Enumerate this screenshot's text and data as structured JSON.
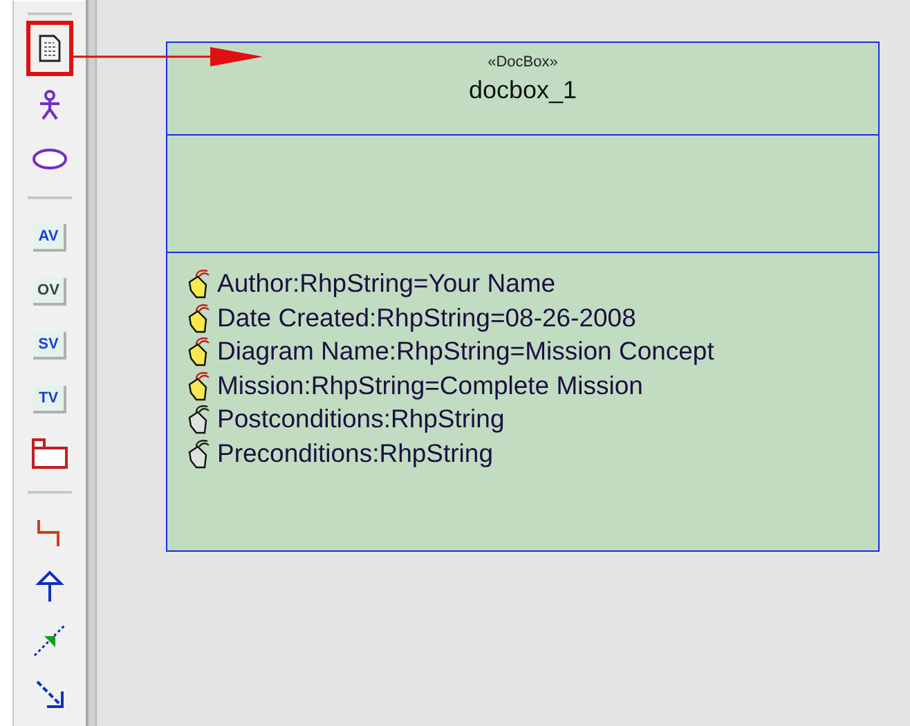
{
  "toolbar": {
    "tools": [
      {
        "kind": "document",
        "highlighted": true
      },
      {
        "kind": "actor",
        "highlighted": false
      },
      {
        "kind": "ellipse",
        "highlighted": false
      },
      {
        "kind": "separator"
      },
      {
        "kind": "text",
        "label": "AV",
        "color": "#2040d0",
        "highlighted": false
      },
      {
        "kind": "text",
        "label": "OV",
        "color": "#404040",
        "highlighted": false
      },
      {
        "kind": "text",
        "label": "SV",
        "color": "#2040d0",
        "highlighted": false
      },
      {
        "kind": "text",
        "label": "TV",
        "color": "#2040d0",
        "highlighted": false
      },
      {
        "kind": "folder",
        "highlighted": false
      },
      {
        "kind": "separator"
      },
      {
        "kind": "connector",
        "highlighted": false
      },
      {
        "kind": "arrow-up",
        "highlighted": false
      },
      {
        "kind": "dependency",
        "highlighted": false
      },
      {
        "kind": "arrow-diagonal",
        "highlighted": false
      }
    ]
  },
  "callout_arrow": true,
  "class_box": {
    "stereotype": "«DocBox»",
    "name": "docbox_1",
    "attributes": [
      {
        "text": "Author:RhpString=Your Name",
        "kind": "valued"
      },
      {
        "text": "Date Created:RhpString=08-26-2008",
        "kind": "valued"
      },
      {
        "text": "Diagram Name:RhpString=Mission Concept",
        "kind": "valued"
      },
      {
        "text": "Mission:RhpString=Complete Mission",
        "kind": "valued"
      },
      {
        "text": "Postconditions:RhpString",
        "kind": "plain"
      },
      {
        "text": "Preconditions:RhpString",
        "kind": "plain"
      }
    ]
  }
}
